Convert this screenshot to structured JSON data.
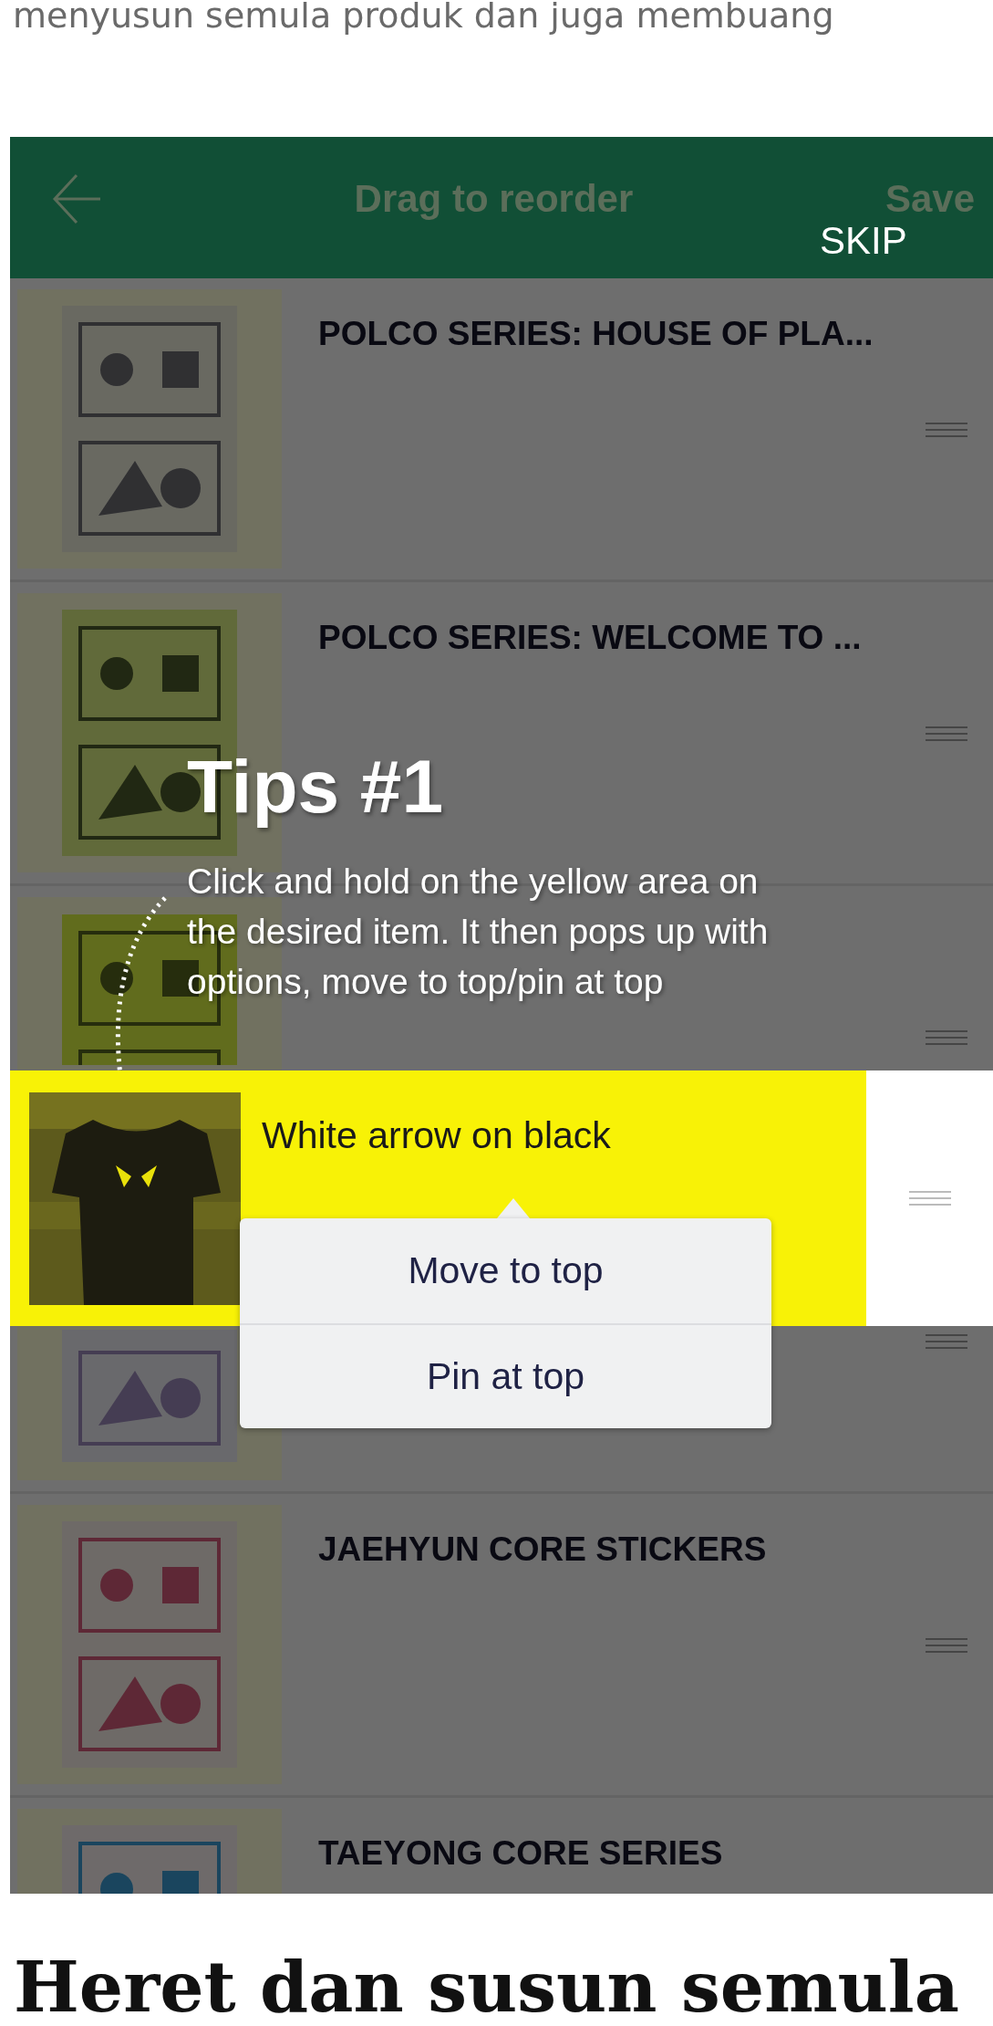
{
  "intro_text": "menyusun semula produk dan juga membuang",
  "app": {
    "header": {
      "title": "Drag to reorder",
      "action": "Save",
      "skip": "SKIP"
    },
    "items": [
      {
        "kind": "product",
        "title": "POLCO SERIES: HOUSE OF PLA..."
      },
      {
        "kind": "product",
        "title": "POLCO SERIES: WELCOME TO ..."
      },
      {
        "kind": "product"
      },
      {
        "kind": "product"
      },
      {
        "kind": "product",
        "title": "JAEHYUN CORE STICKERS"
      },
      {
        "kind": "product",
        "title": "TAEYONG CORE SERIES"
      }
    ],
    "tip": {
      "title": "Tips #1",
      "lines": [
        "Click and hold on the yellow area on",
        "the desired item. It then pops up with",
        "options, move to top/pin at top"
      ]
    },
    "highlighted_item": {
      "title": "White arrow on black"
    },
    "context_menu": [
      {
        "label": "Move to top"
      },
      {
        "label": "Pin at top"
      }
    ]
  },
  "heading": "Heret dan susun semula"
}
